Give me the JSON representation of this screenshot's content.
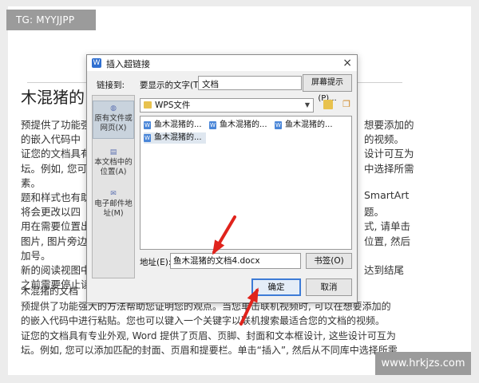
{
  "watermark": "TG: MYYJJPP",
  "site_badge": "www.hrkjzs.com",
  "document": {
    "heading": "木混猪的",
    "lines_left": [
      "预提供了功能强",
      "的嵌入代码中",
      "证您的文档具有",
      "坛。例如, 您可",
      "素。",
      "题和样式也有助",
      "将会更改以四",
      "用在需要位置出",
      "图片, 图片旁边",
      "加号。",
      "新的阅读视图中",
      "之前需要停止读"
    ],
    "lines_right": [
      "想要添加的",
      "的视频。",
      "设计可互为",
      "中选择所需",
      "",
      "SmartArt",
      "题。",
      "式, 请单击",
      "位置, 然后",
      "",
      "达到结尾",
      ""
    ],
    "bottom_lines": [
      "木混猪的文档",
      "预提供了功能强大的方法帮助您证明您的观点。当您单击联机视频时, 可以在想要添加的",
      "的嵌入代码中进行粘贴。您也可以键入一个关键字以联机搜索最适合您的文档的视频。",
      "证您的文档具有专业外观, Word 提供了页眉、页脚、封面和文本框设计, 这些设计可互为",
      "坛。例如, 您可以添加匹配的封面、页眉和提要栏。单击“插入”, 然后从不同库中选择所需"
    ]
  },
  "dialog": {
    "title": "插入超链接",
    "app_icon_glyph": "W",
    "close_glyph": "×",
    "link_to_label": "链接到:",
    "display_text_label": "要显示的文字(T):",
    "display_text_value": "文档",
    "screentip_button": "屏幕提示(P)...",
    "sidebar": [
      {
        "label": "原有文件或网页(X)",
        "icon": "globe-icon"
      },
      {
        "label": "本文档中的位置(A)",
        "icon": "document-icon"
      },
      {
        "label": "电子邮件地址(M)",
        "icon": "mail-icon"
      }
    ],
    "folder": "WPS文件",
    "files": [
      "鱼木混猪的...",
      "鱼木混猪的...",
      "鱼木混猪的...",
      "鱼木混猪的..."
    ],
    "address_label": "地址(E):",
    "address_value": "鱼木混猪的文档4.docx",
    "bookmark_button": "书签(O)",
    "ok_button": "确定",
    "cancel_button": "取消"
  },
  "colors": {
    "arrow": "#e0231c",
    "ok_border": "#3d7bd6",
    "folder": "#e8c24e"
  }
}
